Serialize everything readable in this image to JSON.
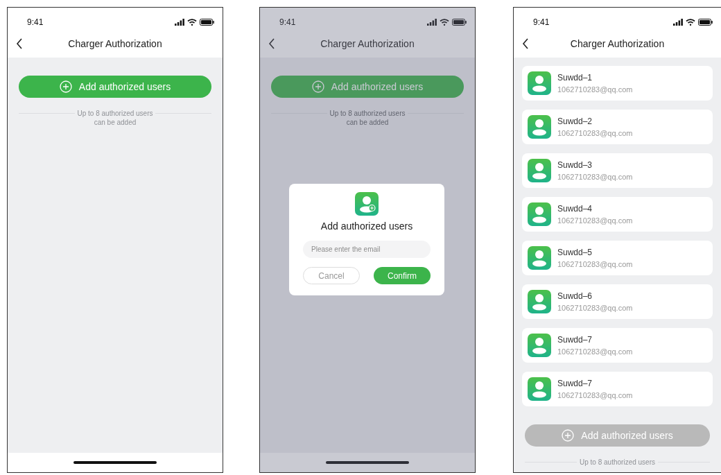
{
  "screens": [
    {
      "status_bar": {
        "time": "9:41"
      },
      "title": "Charger Authorization",
      "dimmed": false,
      "add_button": {
        "label": "Add authorized users",
        "disabled": false
      },
      "hint": [
        "Up to 8 authorized users",
        "can be added"
      ],
      "home_indicator": true
    },
    {
      "status_bar": {
        "time": "9:41"
      },
      "title": "Charger Authorization",
      "dimmed": true,
      "add_button": {
        "label": "Add authorized users",
        "disabled": false
      },
      "hint": [
        "Up to 8 authorized users",
        "can be added"
      ],
      "home_indicator": true,
      "dialog": {
        "title": "Add authorized users",
        "email_field": {
          "placeholder": "Please enter the email"
        },
        "buttons": [
          {
            "label": "Cancel",
            "kind": "secondary"
          },
          {
            "label": "Confirm",
            "kind": "primary"
          }
        ]
      }
    },
    {
      "status_bar": {
        "time": "9:41"
      },
      "title": "Charger Authorization",
      "dimmed": false,
      "users": [
        {
          "name": "Suwdd–1",
          "email": "1062710283@qq.com"
        },
        {
          "name": "Suwdd–2",
          "email": "1062710283@qq.com"
        },
        {
          "name": "Suwdd–3",
          "email": "1062710283@qq.com"
        },
        {
          "name": "Suwdd–4",
          "email": "1062710283@qq.com"
        },
        {
          "name": "Suwdd–5",
          "email": "1062710283@qq.com"
        },
        {
          "name": "Suwdd–6",
          "email": "1062710283@qq.com"
        },
        {
          "name": "Suwdd–7",
          "email": "1062710283@qq.com"
        },
        {
          "name": "Suwdd–7",
          "email": "1062710283@qq.com"
        }
      ],
      "add_button": {
        "label": "Add authorized users",
        "disabled": true
      },
      "hint": [
        "Up to 8 authorized users"
      ],
      "home_indicator": false
    }
  ]
}
